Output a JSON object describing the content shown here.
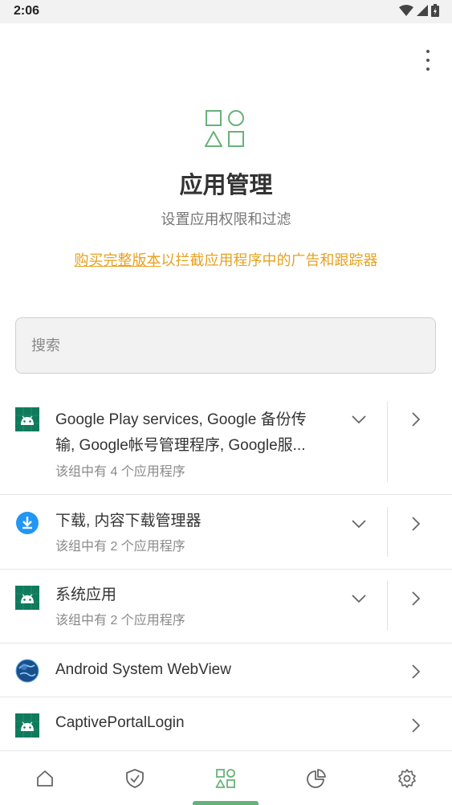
{
  "status": {
    "time": "2:06"
  },
  "header": {
    "title": "应用管理",
    "subtitle": "设置应用权限和过滤",
    "promo_link": "购买完整版本",
    "promo_text": "以拦截应用程序中的广告和跟踪器"
  },
  "search": {
    "placeholder": "搜索",
    "value": ""
  },
  "groups": [
    {
      "icon": "android-icon",
      "title_line1": "Google Play services, Google 备份传",
      "title_line2": "输, Google帐号管理程序, Google服...",
      "subtitle": "该组中有 4 个应用程序"
    },
    {
      "icon": "download-icon",
      "title": "下载, 内容下载管理器",
      "subtitle": "该组中有 2 个应用程序"
    },
    {
      "icon": "android-icon",
      "title": "系统应用",
      "subtitle": "该组中有 2 个应用程序"
    }
  ],
  "apps": [
    {
      "icon": "webview-globe-icon",
      "title": "Android System WebView"
    },
    {
      "icon": "android-icon",
      "title": "CaptivePortalLogin"
    }
  ],
  "nav": {
    "items": [
      "home-icon",
      "shield-icon",
      "apps-icon",
      "pie-chart-icon",
      "gear-icon"
    ],
    "active_index": 2
  },
  "colors": {
    "accent": "#67b279",
    "promo": "#e6a21f",
    "android_tile": "#0f7a5c",
    "download_blue": "#2196f3"
  }
}
